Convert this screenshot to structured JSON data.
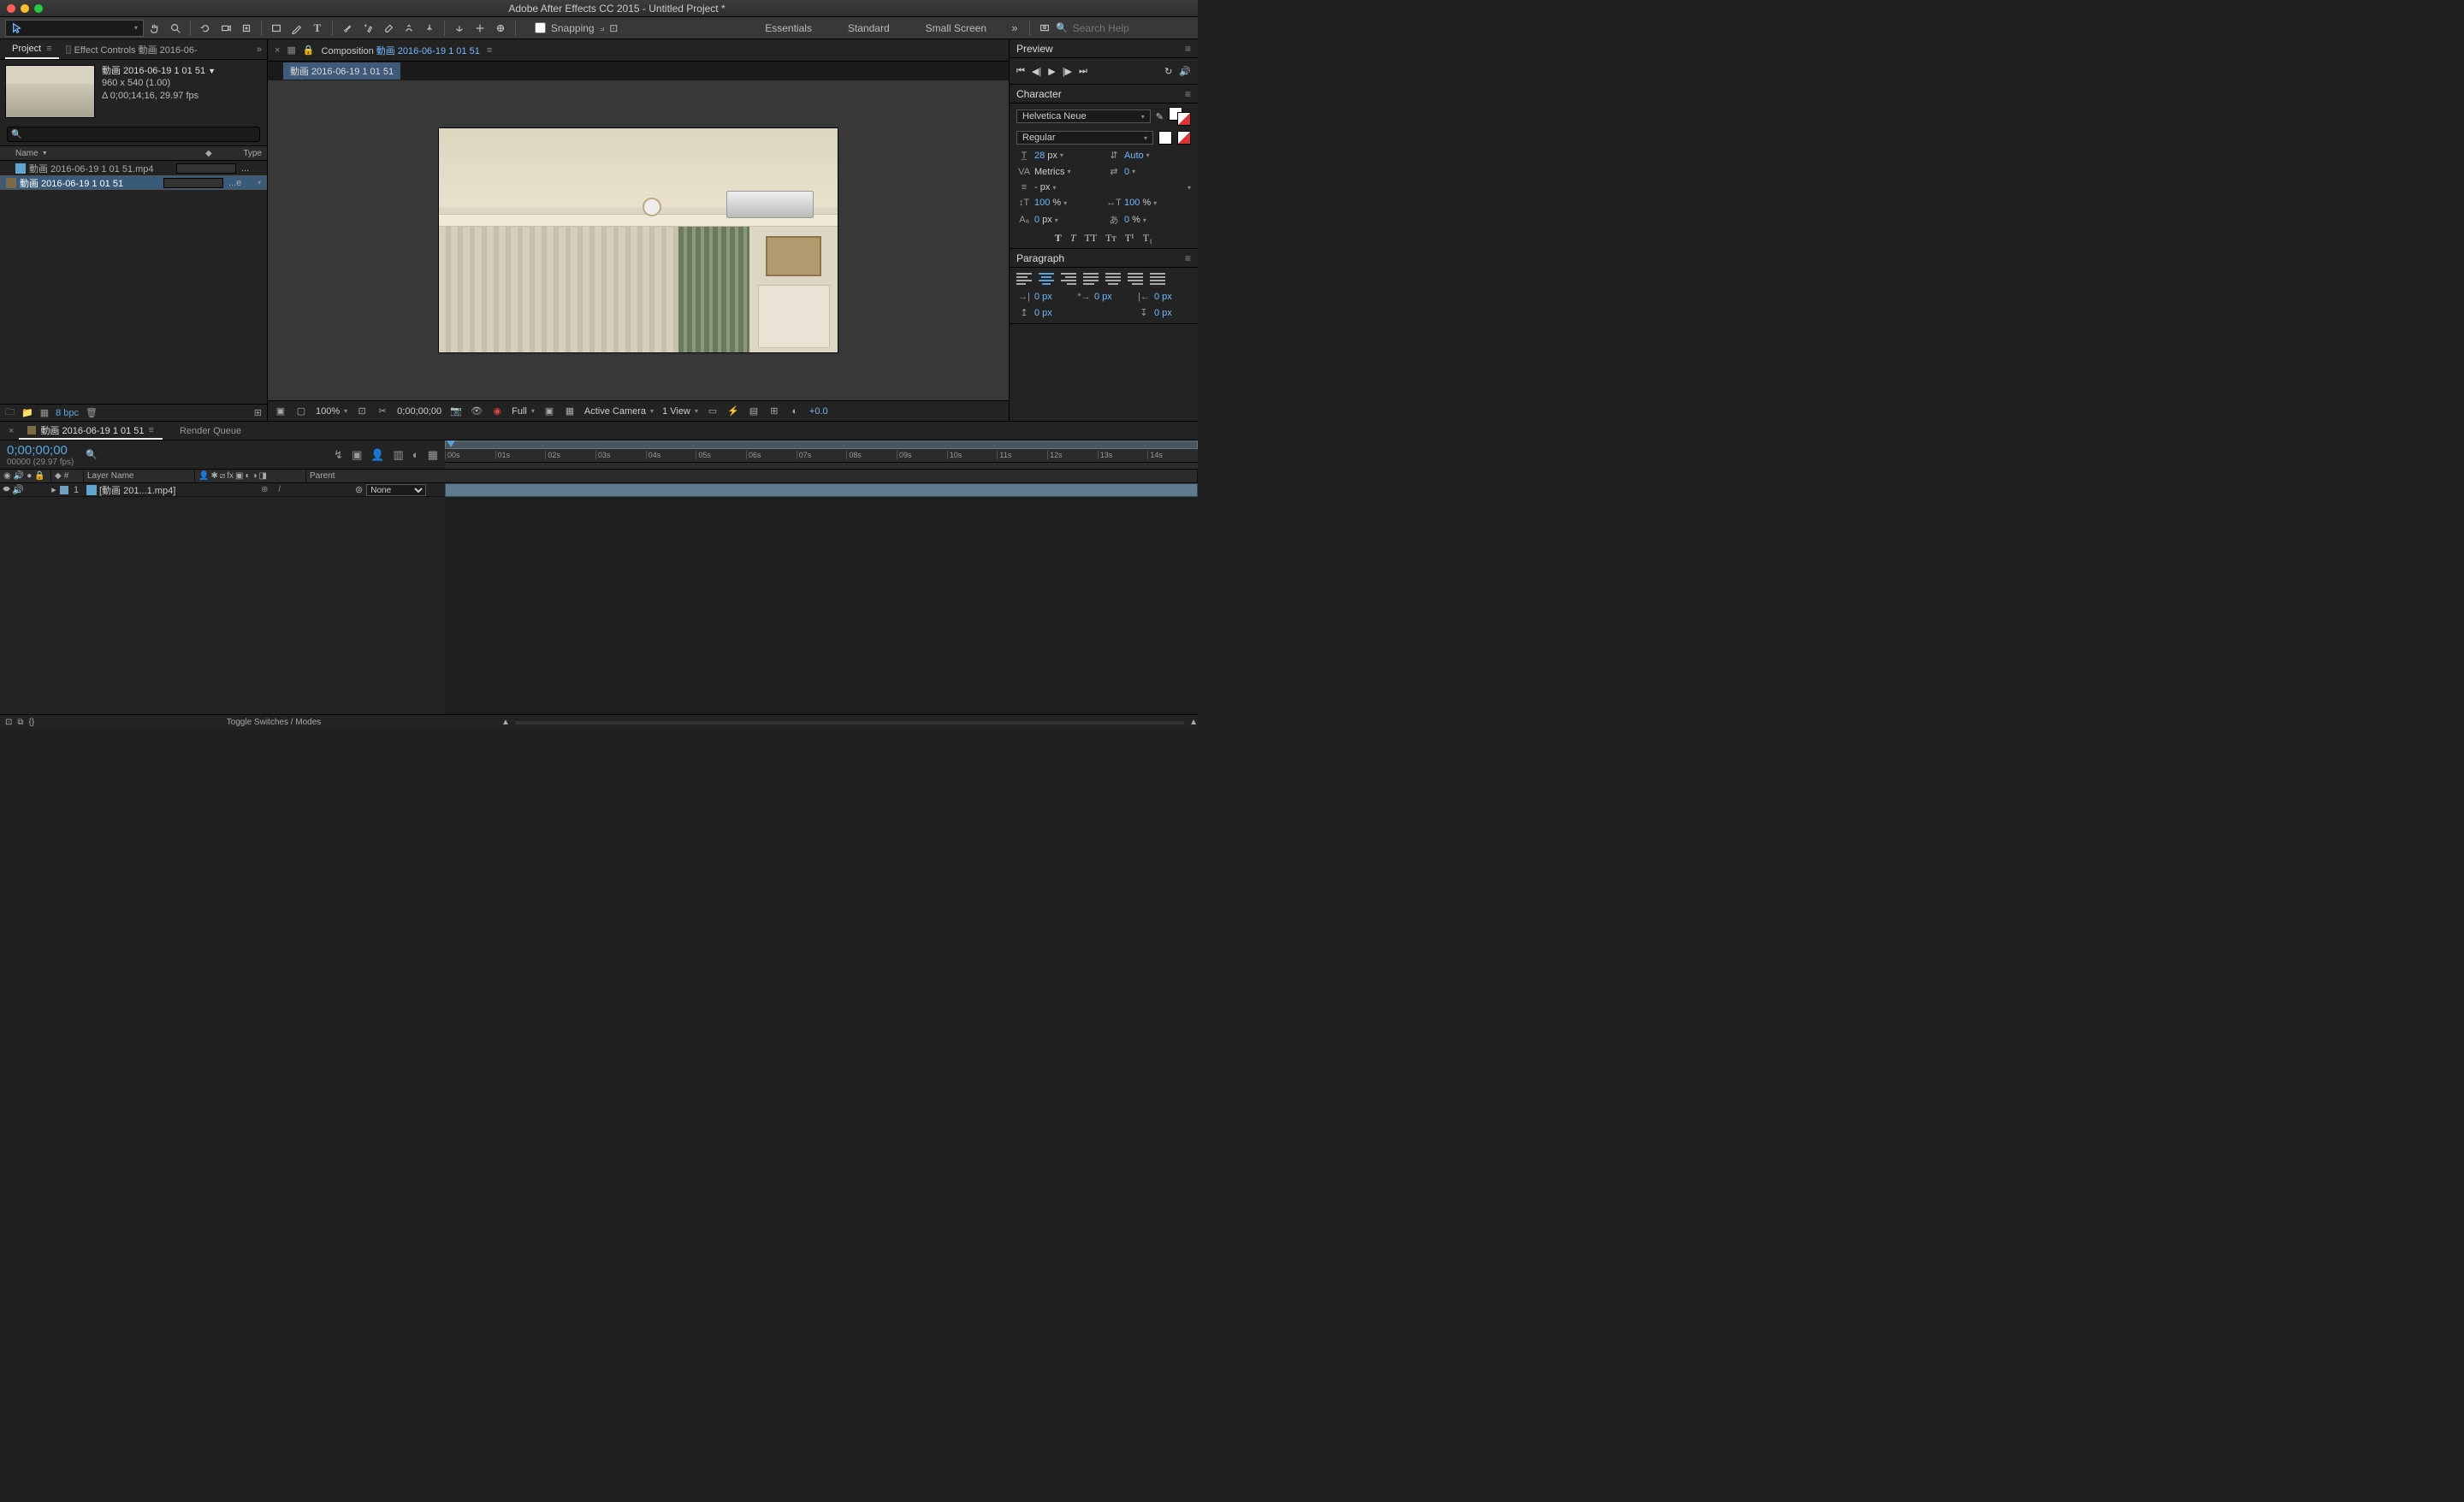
{
  "titlebar": {
    "title": "Adobe After Effects CC 2015 - Untitled Project *"
  },
  "toolbar": {
    "snapping_label": "Snapping",
    "workspaces": [
      "Essentials",
      "Standard",
      "Small Screen"
    ],
    "search_placeholder": "Search Help"
  },
  "panels": {
    "project_tab": "Project",
    "effect_tab": "Effect Controls 動画 2016-06-",
    "comp_tab_prefix": "Composition",
    "comp_name": "動画 2016-06-19 1 01 51",
    "flow_name": "動画 2016-06-19 1 01 51"
  },
  "project": {
    "selected_name": "動画 2016-06-19 1 01 51",
    "dims": "960 x 540 (1.00)",
    "duration": "Δ 0;00;14;16, 29.97 fps",
    "cols": {
      "name": "Name",
      "type": "Type"
    },
    "items": [
      {
        "type": "footage",
        "name": "動画 2016-06-19 1 01 51.mp4",
        "typestr": "..."
      },
      {
        "type": "comp",
        "name": "動画 2016-06-19 1 01 51",
        "typestr": "...e"
      }
    ],
    "bpc": "8 bpc"
  },
  "comp_footer": {
    "zoom": "100%",
    "timecode": "0;00;00;00",
    "res": "Full",
    "camera": "Active Camera",
    "view": "1 View",
    "exposure": "+0.0"
  },
  "preview": {
    "title": "Preview"
  },
  "character": {
    "title": "Character",
    "font": "Helvetica Neue",
    "style": "Regular",
    "size": "28",
    "size_unit": "px",
    "leading": "Auto",
    "kerning": "Metrics",
    "tracking": "0",
    "leading2": "- px",
    "vscale": "100",
    "hscale": "100",
    "pct": "%",
    "baseline": "0",
    "tsume": "0",
    "px": "px",
    "pct2": "%"
  },
  "paragraph": {
    "title": "Paragraph",
    "indents": {
      "left": "0 px",
      "right": "0 px",
      "first": "0 px",
      "before": "0 px",
      "after": "0 px"
    }
  },
  "timeline": {
    "tab_name": "動画 2016-06-19 1 01 51",
    "render_queue": "Render Queue",
    "timecode": "0;00;00;00",
    "frames": "00000 (29.97 fps)",
    "cols": {
      "num": "#",
      "layer": "Layer Name",
      "parent": "Parent"
    },
    "ruler": [
      "00s",
      "01s",
      "02s",
      "03s",
      "04s",
      "05s",
      "06s",
      "07s",
      "08s",
      "09s",
      "10s",
      "11s",
      "12s",
      "13s",
      "14s"
    ],
    "layers": [
      {
        "num": "1",
        "name": "[動画 201...1.mp4]",
        "parent": "None"
      }
    ],
    "toggle_label": "Toggle Switches / Modes"
  }
}
